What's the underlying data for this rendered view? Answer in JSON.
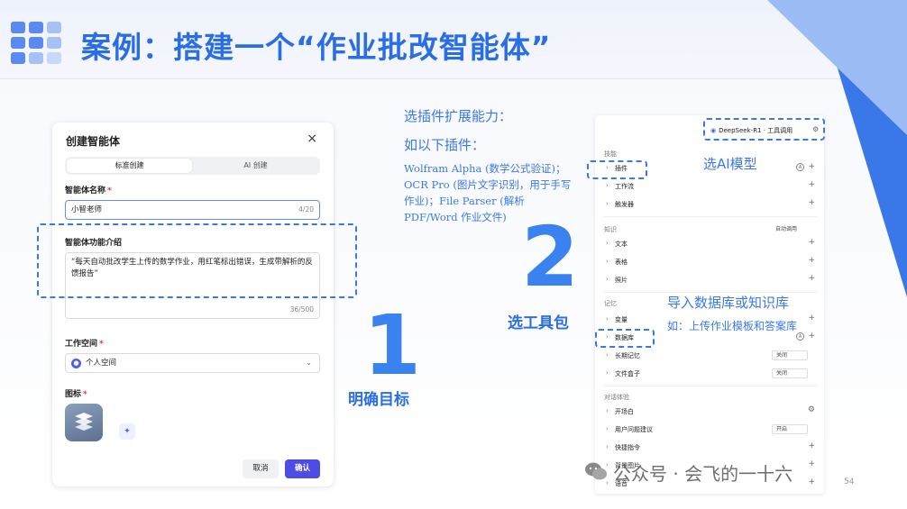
{
  "title": "案例：搭建一个“作业批改智能体”",
  "dialog": {
    "title": "创建智能体",
    "close": "×",
    "tabs": [
      "标准创建",
      "AI 创建"
    ],
    "name_label": "智能体名称",
    "name_value": "小智老师",
    "name_count": "4/20",
    "desc_label": "智能体功能介绍",
    "desc_value": "“每天自动批改学生上传的数学作业，用红笔标出错误，生成带解析的反馈报告”",
    "desc_count": "36/500",
    "workspace_label": "工作空间",
    "workspace_value": "个人空间",
    "icon_label": "图标",
    "cancel": "取消",
    "confirm": "确认",
    "required_mark": "*"
  },
  "steps": {
    "one_num": "1",
    "one_label": "明确目标",
    "two_num": "2",
    "two_label": "选工具包"
  },
  "middle": {
    "heading1": "选插件扩展能力：",
    "heading2": "如以下插件：",
    "body": "Wolfram Alpha (数学公式验证)；OCR Pro (图片文字识别，用于手写作业)；File Parser (解析PDF/Word 作业文件)"
  },
  "panel": {
    "model": "DeepSeek-R1 · 工具调用",
    "sections": {
      "skills": "技能",
      "knowledge": "知识",
      "memory": "记忆",
      "dialog": "对话体验"
    },
    "auto_call": "自动调用",
    "rows": {
      "plugin": "插件",
      "workflow": "工作流",
      "trigger": "触发器",
      "text": "文本",
      "table": "表格",
      "photo": "照片",
      "variable": "变量",
      "database": "数据库",
      "long_memory": "长期记忆",
      "file_box": "文件盒子",
      "opening": "开场白",
      "suggest": "用户问题建议",
      "shortcut": "快捷指令",
      "background": "背景图片",
      "voice": "语音"
    },
    "select_off": "关闭",
    "select_on": "开启"
  },
  "annotations": {
    "model": "选AI模型",
    "import": "导入数据库或知识库",
    "example": "如：上传作业模板和答案库"
  },
  "watermark": "公众号 · 会飞的一十六",
  "page_number": "54",
  "colors": {
    "accent": "#3a78ea",
    "confirm": "#4e4ce6"
  }
}
